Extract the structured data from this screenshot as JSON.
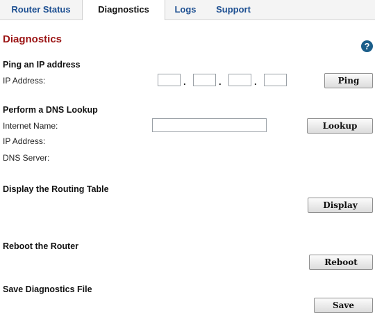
{
  "tabs": [
    {
      "label": "Router Status"
    },
    {
      "label": "Diagnostics"
    },
    {
      "label": "Logs"
    },
    {
      "label": "Support"
    }
  ],
  "page": {
    "title": "Diagnostics",
    "help_glyph": "?"
  },
  "ping": {
    "heading": "Ping an IP address",
    "ip_label": "IP Address:",
    "octets": [
      "",
      "",
      "",
      ""
    ],
    "separator": ".",
    "button": "Ping"
  },
  "dns": {
    "heading": "Perform a DNS Lookup",
    "name_label": "Internet Name:",
    "name_value": "",
    "ip_label": "IP Address:",
    "server_label": "DNS Server:",
    "button": "Lookup"
  },
  "routing": {
    "heading": "Display the Routing Table",
    "button": "Display"
  },
  "reboot": {
    "heading": "Reboot the Router",
    "button": "Reboot"
  },
  "save": {
    "heading": "Save Diagnostics File",
    "button": "Save"
  },
  "colors": {
    "title": "#9b1414",
    "tab_link": "#1d4f91",
    "help_icon": "#1b5e8a"
  },
  "icons": {
    "help": "help-circle-icon"
  }
}
